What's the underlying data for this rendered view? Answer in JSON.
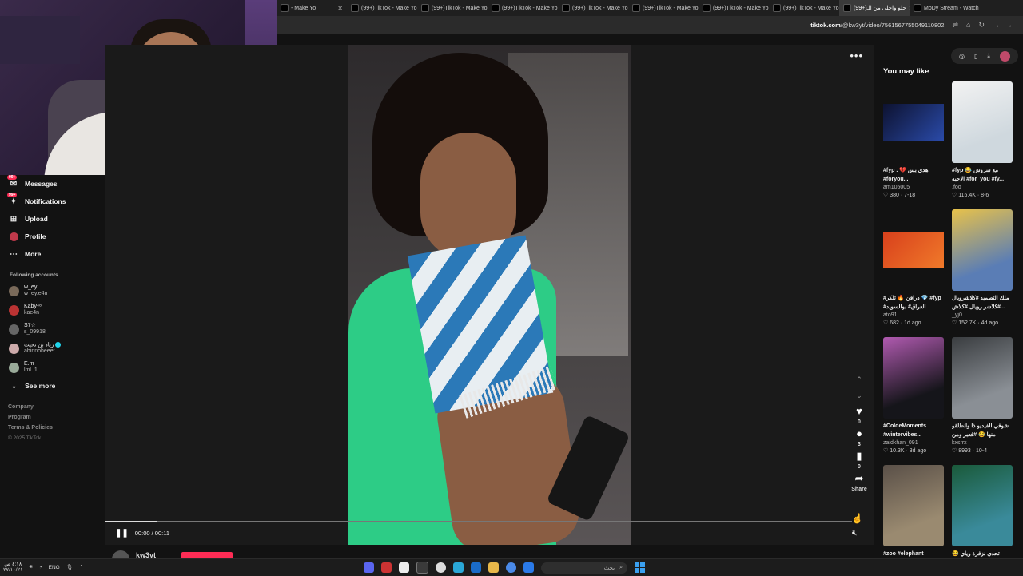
{
  "browser": {
    "tabs": [
      {
        "label": "- Make Yo",
        "active": false
      },
      {
        "label": "(99+)TikTok - Make Yo",
        "active": false
      },
      {
        "label": "(99+)TikTok - Make Yo",
        "active": false
      },
      {
        "label": "(99+)TikTok - Make Yo",
        "active": false
      },
      {
        "label": "(99+)TikTok - Make Yo",
        "active": false
      },
      {
        "label": "(99+)TikTok - Make Yo",
        "active": false
      },
      {
        "label": "(99+)TikTok - Make Yo",
        "active": false
      },
      {
        "label": "(99+)TikTok - Make Yo",
        "active": false
      },
      {
        "label": "(99+)حلو واحلى من الـ",
        "active": true
      },
      {
        "label": "MoDy Stream - Watch",
        "active": false
      }
    ],
    "url_domain": "tiktok.com",
    "url_path": "/@kw3yt/video/7561567755049110802"
  },
  "sidebar": {
    "items": [
      {
        "label": "Messages",
        "icon": "messages-icon",
        "badge": "99+"
      },
      {
        "label": "Notifications",
        "icon": "notifications-icon",
        "badge": "99+"
      },
      {
        "label": "Upload",
        "icon": "upload-icon",
        "badge": ""
      },
      {
        "label": "Profile",
        "icon": "profile-icon",
        "badge": ""
      },
      {
        "label": "More",
        "icon": "more-icon",
        "badge": ""
      }
    ],
    "following_title": "Following accounts",
    "accounts": [
      {
        "name": "w_ey",
        "username": "w_ey.e4n",
        "color": "#7a6a5a"
      },
      {
        "name": "Kaby⁴⁸",
        "username": "kae4n",
        "color": "#b33"
      },
      {
        "name": "S7☆",
        "username": "s_09918",
        "color": "#666"
      },
      {
        "name": "زياد بن نحيت",
        "username": "abinnoheeet",
        "color": "#caa",
        "verified": true
      },
      {
        "name": "E.m",
        "username": "lml..1",
        "color": "#9a9"
      }
    ],
    "see_more": "See more",
    "footer": [
      "Company",
      "Program",
      "Terms & Policies"
    ],
    "copyright": "© 2025 TikTok"
  },
  "player": {
    "more": "•••",
    "likes": "0",
    "comments": "3",
    "saves": "0",
    "share_label": "Share",
    "time": "00:00 / 00:11",
    "progress": 0.07,
    "author": "kw3yt"
  },
  "right": {
    "title": "You may like",
    "cards": [
      {
        "caption": "#fyp . 💔 اهدي بس #foryou...",
        "author": "am105005",
        "stats": "♡ 380 · 7-18",
        "bg": "#0d1230",
        "accent": "#2a4aa8",
        "small": true
      },
      {
        "caption": "#fyp 😂 مع سروش الاحيه #for_you #fy...",
        "author": ".foo",
        "stats": "♡ 116.4K · 8-6",
        "bg": "#cfd8de",
        "accent": "#f2f2f2",
        "small": false
      },
      {
        "caption": "#دراقن 🔥 تلكر 💎 #fyp #العراق# بوالسويد",
        "author": "ato91",
        "stats": "♡ 682 · 1d ago",
        "bg": "#d8401c",
        "accent": "#f07a2a",
        "small": true
      },
      {
        "caption": "ملك التصميد #كلاشرويال #كلاشر رويال #كلاش...",
        "author": "_yj0",
        "stats": "♡ 152.7K · 4d ago",
        "bg": "#5a7db5",
        "accent": "#e8c24a",
        "small": false
      },
      {
        "caption": "#ColdeMoments #wintervibes...",
        "author": "zaidkhan_091",
        "stats": "♡ 10.3K · 3d ago",
        "bg": "#15151a",
        "accent": "#b05ab0",
        "small": false
      },
      {
        "caption": "شوفي الفيديو ذا وانطلقو منها 😂 #فعبر ومن #فزرات",
        "author": "kxsrrx",
        "stats": "♡ 8993 · 10-4",
        "bg": "#8a8f95",
        "accent": "#3a3d40",
        "small": false
      },
      {
        "caption": "#zoo #elephant",
        "author": "",
        "stats": "",
        "bg": "#9a8a70",
        "accent": "#5a5048",
        "small": false
      },
      {
        "caption": "😂 تحدي نزفرة وياي",
        "author": "",
        "stats": "",
        "bg": "#3a8a9a",
        "accent": "#1a5a3a",
        "small": false
      }
    ]
  },
  "taskbar": {
    "time": "٤:١٨ ص",
    "date": "٢٧/١٠/٢١",
    "lang": "ENG",
    "search_placeholder": "بحث"
  }
}
